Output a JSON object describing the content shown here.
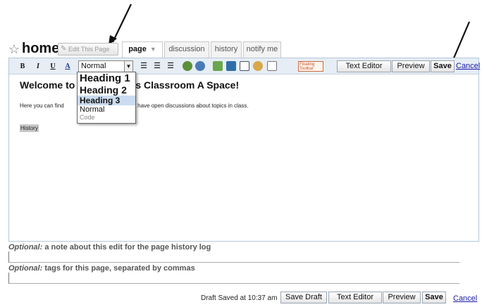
{
  "header": {
    "page_name": "home",
    "edit_button": "Edit This Page",
    "tabs": [
      {
        "label": "page",
        "active": true
      },
      {
        "label": "discussion",
        "active": false
      },
      {
        "label": "history",
        "active": false
      },
      {
        "label": "notify me",
        "active": false
      }
    ]
  },
  "toolbar": {
    "bold": "B",
    "italic": "I",
    "underline": "U",
    "color": "A",
    "style_value": "Normal",
    "floating_toolbar": "Floating Toolbar",
    "text_editor": "Text Editor",
    "preview": "Preview",
    "save": "Save",
    "cancel": "Cancel"
  },
  "dropdown": {
    "options": [
      "Heading 1",
      "Heading 2",
      "Heading 3",
      "Normal",
      "Code"
    ],
    "highlighted": "Heading 3"
  },
  "content": {
    "heading_left": "Welcome to",
    "heading_right": "s Classroom A Space!",
    "paragraph_left": "Here you can find",
    "paragraph_right": "rk and have open discussions about topics in class.",
    "highlight_word": "History"
  },
  "edit_note": {
    "optional": "Optional:",
    "label": "a note about this edit for the page history log"
  },
  "tags": {
    "optional": "Optional:",
    "label": "tags for this page, separated by commas"
  },
  "footer": {
    "draft_status": "Draft Saved at 10:37 am",
    "save_draft": "Save Draft",
    "text_editor": "Text Editor",
    "preview": "Preview",
    "save": "Save",
    "cancel": "Cancel"
  },
  "colors": {
    "toolbar_bg": "#e6edf5",
    "frame_border": "#b6c7d9",
    "link": "#1a1aa6",
    "highlight": "#cbdcf0"
  }
}
